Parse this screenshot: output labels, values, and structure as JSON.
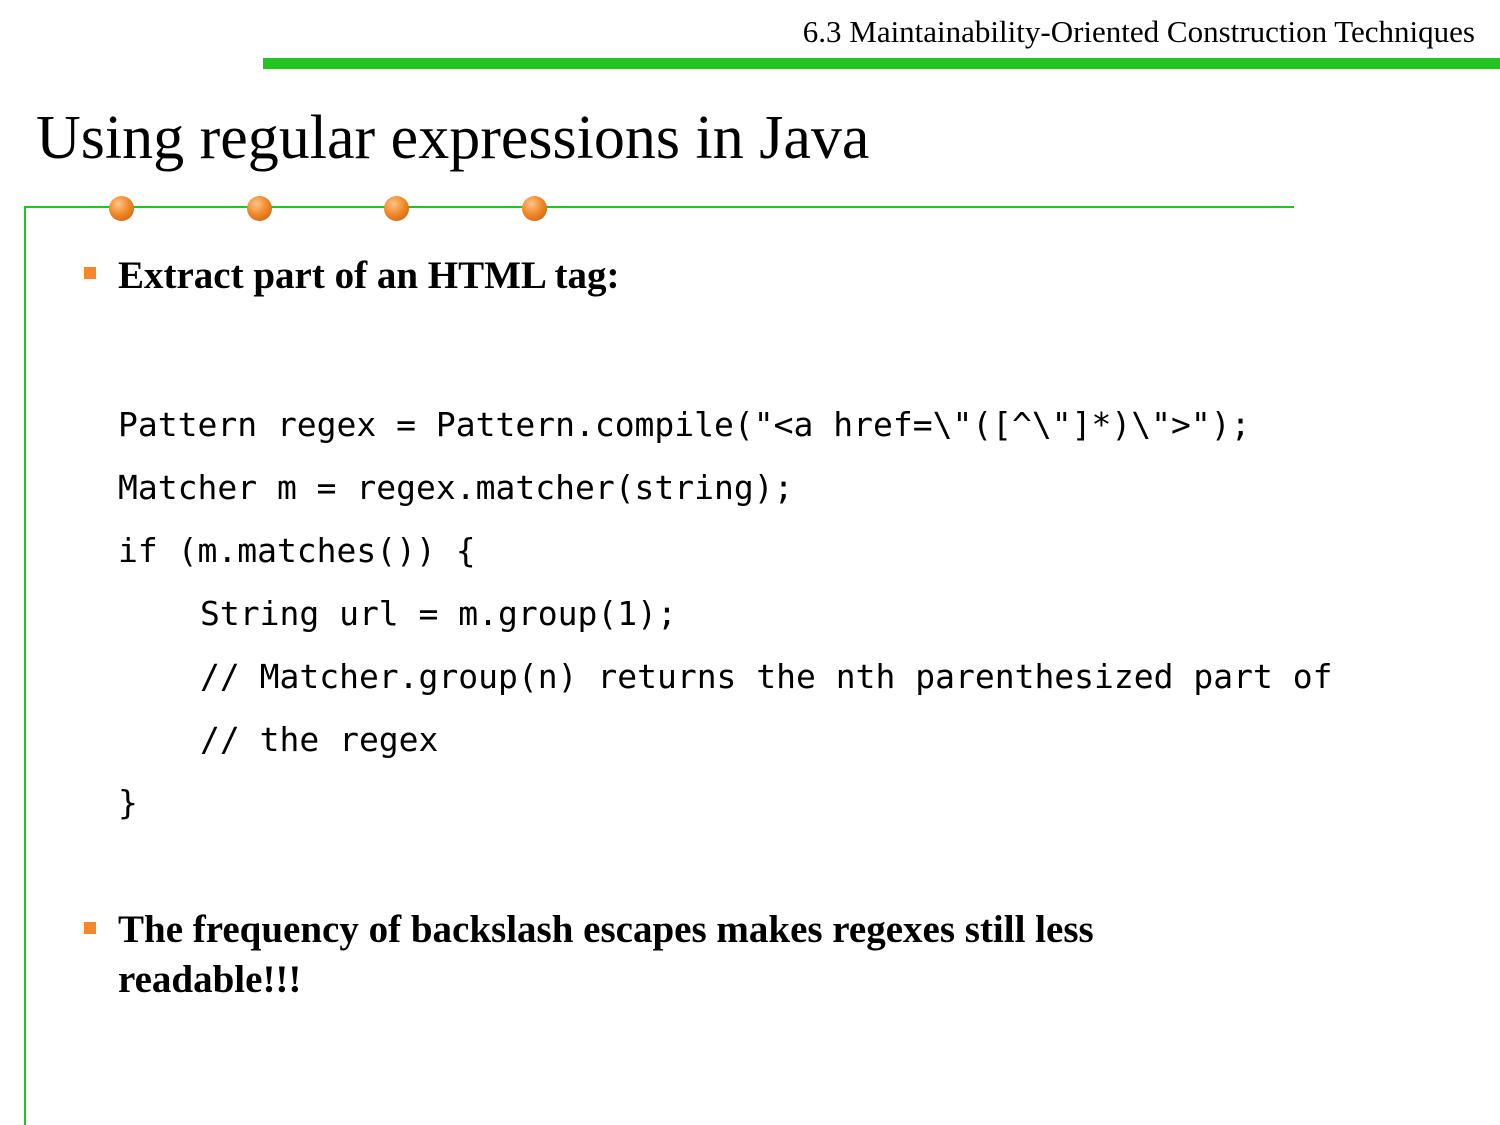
{
  "header": {
    "section_title": "6.3 Maintainability-Oriented Construction Techniques"
  },
  "slide": {
    "title": "Using regular expressions in Java"
  },
  "bullets": [
    "Extract part of an HTML tag:",
    "The frequency of backslash escapes makes regexes still less readable!!!"
  ],
  "code": [
    "Pattern regex = Pattern.compile(\"<a href=\\\"([^\\\"]*)\\\">\");",
    "Matcher m = regex.matcher(string);",
    "if (m.matches()) {",
    "String url = m.group(1);",
    "// Matcher.group(n) returns the nth parenthesized part of",
    "// the regex",
    "}"
  ],
  "colors": {
    "accent_green": "#22c422",
    "bullet_orange": "#f5872a",
    "dot_orange": "#f08a2a"
  }
}
